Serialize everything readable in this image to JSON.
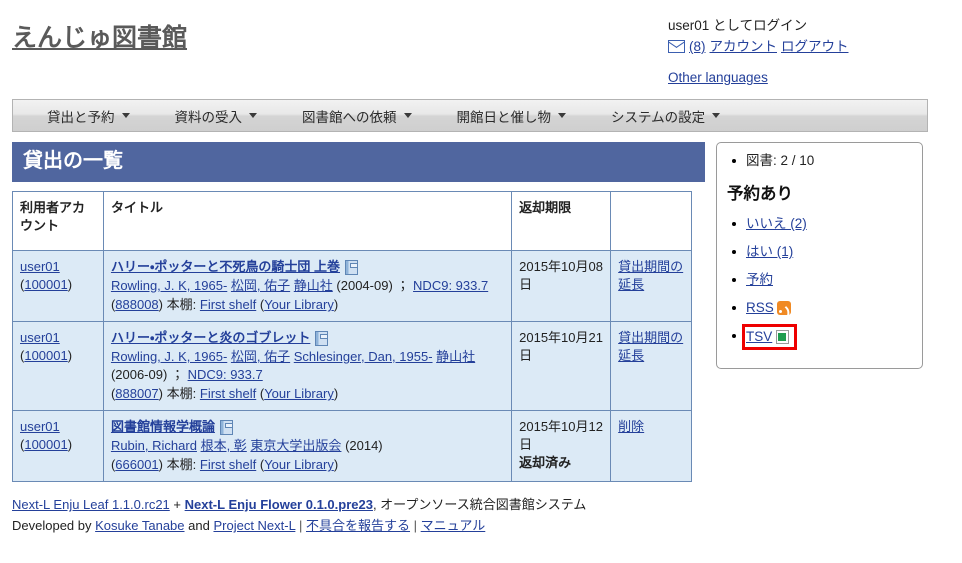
{
  "header": {
    "logo": "えんじゅ図書館",
    "login_status": "user01 としてログイン",
    "mail_icon": "mail-icon",
    "message_count": "(8)",
    "account_link": "アカウント",
    "logout_link": "ログアウト",
    "other_languages": "Other languages"
  },
  "nav": {
    "items": [
      {
        "label": "貸出と予約"
      },
      {
        "label": "資料の受入"
      },
      {
        "label": "図書館への依頼"
      },
      {
        "label": "開館日と催し物"
      },
      {
        "label": "システムの設定"
      }
    ]
  },
  "main": {
    "page_title": "貸出の一覧",
    "table": {
      "columns": [
        "利用者アカウント",
        "タイトル",
        "返却期限",
        ""
      ],
      "rows": [
        {
          "account_name": "user01",
          "account_id": "(100001)",
          "title": "ハリー・ポッターと不死鳥の騎士団 上巻",
          "authors": [
            "Rowling, J. K, 1965-",
            "松岡, 佑子"
          ],
          "publisher": "静山社",
          "pubdate": "(2004-09)",
          "separator": "；",
          "classification": "NDC9: 933.7",
          "item_id": "(888008)",
          "shelf_label": "本棚:",
          "shelf": "First shelf",
          "library": "(Your Library)",
          "due_date": "2015年10月08日",
          "returned": "",
          "action": "貸出期間の延長"
        },
        {
          "account_name": "user01",
          "account_id": "(100001)",
          "title": "ハリー・ポッターと炎のゴブレット",
          "authors": [
            "Rowling, J. K, 1965-",
            "松岡, 佑子",
            "Schlesinger, Dan, 1955-"
          ],
          "publisher": "静山社",
          "pubdate": "(2006-09)",
          "separator": "；",
          "classification": "NDC9: 933.7",
          "item_id": "(888007)",
          "shelf_label": "本棚:",
          "shelf": "First shelf",
          "library": "(Your Library)",
          "due_date": "2015年10月21日",
          "returned": "",
          "action": "貸出期間の延長"
        },
        {
          "account_name": "user01",
          "account_id": "(100001)",
          "title": "図書館情報学概論",
          "authors": [
            "Rubin, Richard",
            "根本, 彰"
          ],
          "publisher": "東京大学出版会",
          "pubdate": "(2014)",
          "separator": "",
          "classification": "",
          "item_id": "(666001)",
          "shelf_label": "本棚:",
          "shelf": "First shelf",
          "library": "(Your Library)",
          "due_date": "2015年10月12日",
          "returned": "返却済み",
          "action": "削除"
        }
      ]
    }
  },
  "sidebar": {
    "count_label": "図書: 2 / 10",
    "reserve_heading": "予約あり",
    "items": [
      {
        "label": "いいえ (2)",
        "icon": ""
      },
      {
        "label": "はい (1)",
        "icon": ""
      },
      {
        "label": "予約",
        "icon": ""
      },
      {
        "label": "RSS",
        "icon": "rss-icon"
      },
      {
        "label": "TSV",
        "icon": "tsv-icon"
      }
    ],
    "highlight_color": "#ee0000"
  },
  "footer": {
    "leaf": "Next-L Enju Leaf 1.1.0.rc21",
    "plus": "+",
    "flower": "Next-L Enju Flower 0.1.0.pre23",
    "tagline": ", オープンソース統合図書館システム",
    "developed_by": "Developed by",
    "author": "Kosuke Tanabe",
    "and": "and",
    "project": "Project Next-L",
    "bug_report": "不具合を報告する",
    "manual": "マニュアル",
    "pipe": "|"
  }
}
